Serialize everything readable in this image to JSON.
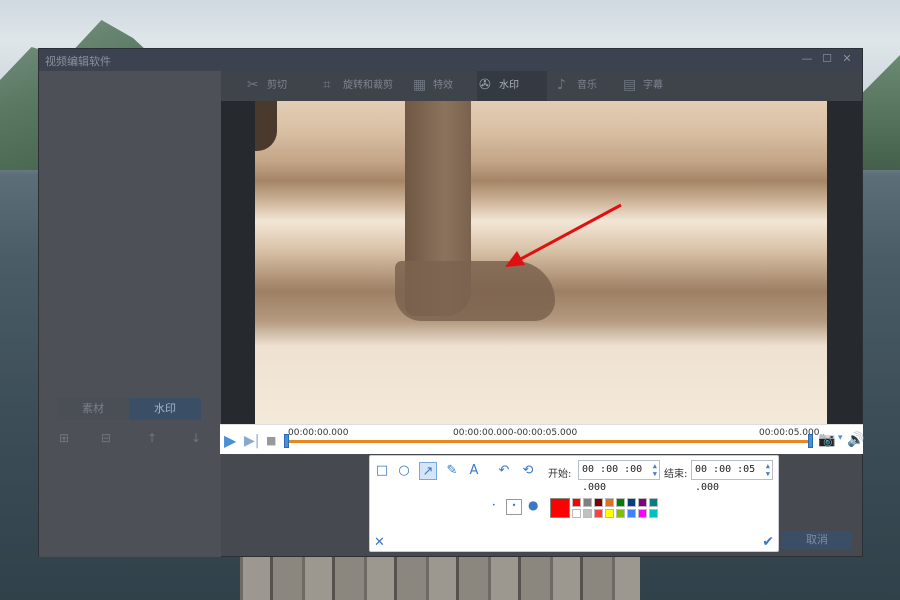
{
  "window": {
    "title": "视频编辑软件",
    "controls": [
      "—",
      "☐",
      "✕"
    ]
  },
  "toolbar": {
    "items": [
      {
        "label": "剪切",
        "icon": "scissors-icon"
      },
      {
        "label": "旋转和裁剪",
        "icon": "crop-icon"
      },
      {
        "label": "特效",
        "icon": "effects-icon"
      },
      {
        "label": "水印",
        "icon": "film-reel-icon",
        "active": true
      },
      {
        "label": "音乐",
        "icon": "music-note-icon"
      },
      {
        "label": "字幕",
        "icon": "subtitle-icon"
      }
    ]
  },
  "left_panel": {
    "tabs": [
      "素材",
      "水印"
    ],
    "active_tab": "水印",
    "tools": [
      "⊞",
      "⊟",
      "↑",
      "↓"
    ]
  },
  "player": {
    "start_time": "00:00:00.000",
    "range_time": "00:00:00.000-00:00:05.000",
    "end_time": "00:00:05.000",
    "progress": 0
  },
  "editor": {
    "tools": [
      {
        "name": "rectangle-tool",
        "glyph": "□"
      },
      {
        "name": "ellipse-tool",
        "glyph": "○"
      },
      {
        "name": "arrow-tool",
        "glyph": "↗",
        "active": true
      },
      {
        "name": "pen-tool",
        "glyph": "✎"
      },
      {
        "name": "text-tool",
        "glyph": "A"
      },
      {
        "name": "undo-tool",
        "glyph": "↶"
      },
      {
        "name": "redo-tool",
        "glyph": "⟲"
      }
    ],
    "start_label": "开始:",
    "start_value": "00 :00 :00 .000",
    "end_label": "结束:",
    "end_value": "00 :00 :05 .000",
    "selected_color": "#ff0000",
    "palette_top": [
      "#ff0000",
      "#808080",
      "#800000",
      "#e07020",
      "#008000",
      "#004080",
      "#800080",
      "#008080"
    ],
    "palette_bottom": [
      "#ffffff",
      "#c0c0c0",
      "#ff4040",
      "#ffff00",
      "#80c000",
      "#4080ff",
      "#ff00ff",
      "#00c0c0"
    ]
  },
  "buttons": {
    "cancel": "取消"
  }
}
